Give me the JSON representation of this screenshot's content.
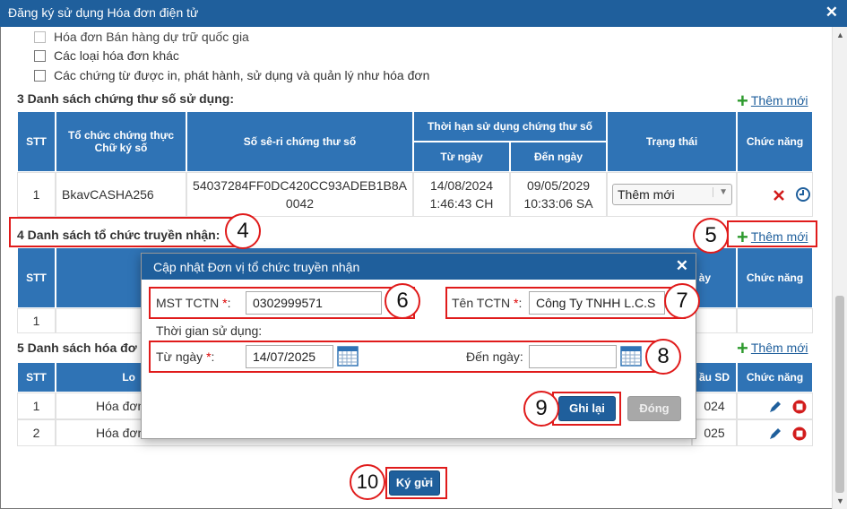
{
  "window": {
    "title": "Đăng ký sử dụng Hóa đơn điện tử",
    "close": "✕"
  },
  "checkboxes": [
    {
      "label": "Hóa đơn Bán hàng dự trữ quốc gia",
      "disabled": true
    },
    {
      "label": "Các loại hóa đơn khác",
      "disabled": false
    },
    {
      "label": "Các chứng từ được in, phát hành, sử dụng và quản lý như hóa đơn",
      "disabled": false
    }
  ],
  "section3": {
    "title": "3 Danh sách chứng thư số sử dụng:",
    "add_label": "Thêm mới",
    "headers": {
      "stt": "STT",
      "org": "Tổ chức chứng thực Chữ ký số",
      "serial": "Số sê-ri chứng thư số",
      "validity": "Thời hạn sử dụng chứng thư số",
      "from": "Từ ngày",
      "to": "Đến ngày",
      "status": "Trạng thái",
      "func": "Chức năng"
    },
    "rows": [
      {
        "stt": "1",
        "org": "BkavCASHA256",
        "serial": "54037284FF0DC420CC93ADEB1B8A0042",
        "from": "14/08/2024 1:46:43 CH",
        "to": "09/05/2029 10:33:06 SA",
        "status": "Thêm mới"
      }
    ]
  },
  "section4": {
    "title": "4 Danh sách tổ chức truyền nhận:",
    "add_label": "Thêm mới",
    "headers": {
      "stt": "STT",
      "func": "Chức năng",
      "partial": "ày"
    },
    "rows": [
      {
        "stt": "1"
      }
    ]
  },
  "section5": {
    "title": "5 Danh sách hóa đơ",
    "add_label": "Thêm mới",
    "headers": {
      "stt": "STT",
      "lo": "Lo",
      "dau": "ầu SD",
      "func": "Chức năng"
    },
    "rows": [
      {
        "stt": "1",
        "name": "Hóa đơn",
        "year": "024"
      },
      {
        "stt": "2",
        "name": "Hóa đơn",
        "year": "025"
      }
    ]
  },
  "modal": {
    "title": "Cập nhật Đơn vị tổ chức truyền nhận",
    "close": "✕",
    "mst_label": "MST TCTN",
    "mst_value": "0302999571",
    "ten_label": "Tên TCTN",
    "ten_value": "Công Ty TNHH L.C.S",
    "time_label": "Thời gian sử dụng:",
    "from_label": "Từ ngày",
    "from_value": "14/07/2025",
    "to_label": "Đến ngày:",
    "to_value": "",
    "req": "*",
    "colon": ":",
    "save_label": "Ghi lại",
    "close_label": "Đóng"
  },
  "submit_label": "Ký gửi",
  "callouts": [
    "4",
    "5",
    "6",
    "7",
    "8",
    "9",
    "10"
  ],
  "colors": {
    "header": "#1f5f9c",
    "table_header": "#2f73b5",
    "callout": "#e01b1b",
    "add_plus": "#2e9a2e"
  }
}
